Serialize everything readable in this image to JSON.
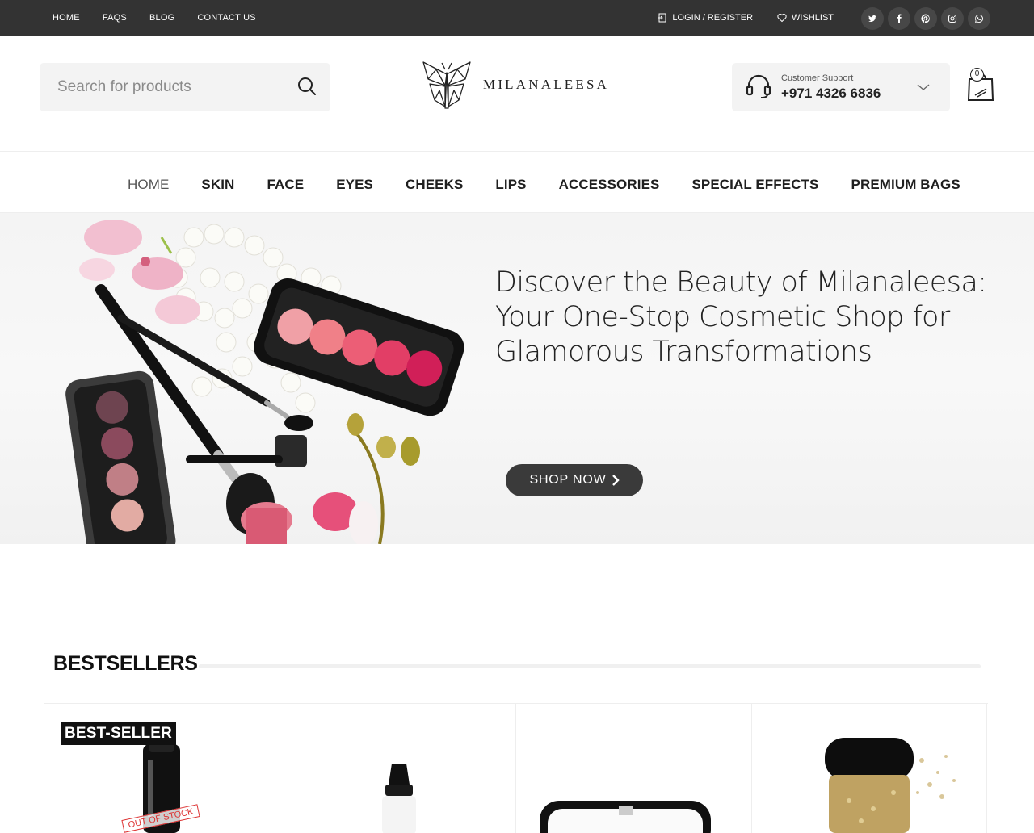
{
  "topbar": {
    "nav": [
      "HOME",
      "FAQS",
      "BLOG",
      "CONTACT US"
    ],
    "login": "LOGIN / REGISTER",
    "wishlist": "WISHLIST",
    "socials": [
      "twitter-icon",
      "facebook-icon",
      "pinterest-icon",
      "instagram-icon",
      "whatsapp-icon"
    ]
  },
  "header": {
    "search_placeholder": "Search for products",
    "logo_text": "MILANALEESA",
    "support_label": "Customer Support",
    "support_phone": "+971 4326 6836",
    "cart_count": "0"
  },
  "mainnav": [
    "HOME",
    "SKIN",
    "FACE",
    "EYES",
    "CHEEKS",
    "LIPS",
    "ACCESSORIES",
    "SPECIAL EFFECTS",
    "PREMIUM BAGS"
  ],
  "hero": {
    "title": "Discover the Beauty of Milanaleesa: Your One-Stop Cosmetic Shop for Glamorous Transformations",
    "button": "SHOP NOW"
  },
  "bestsellers": {
    "title": "BESTSELLERS",
    "badge": "BEST-SELLER",
    "out_of_stock": "OUT OF STOCK"
  },
  "colors": {
    "topbar": "#333333",
    "button": "#3a3a3a",
    "accent_pink": "#e8607d"
  }
}
